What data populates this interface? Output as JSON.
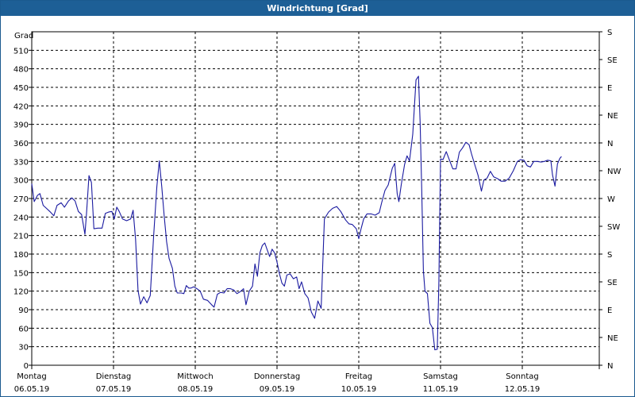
{
  "window": {
    "title": "Windrichtung [Grad]"
  },
  "chart_data": {
    "type": "line",
    "title": "Windrichtung [Grad]",
    "ylabel": "Grad",
    "ylim": [
      0,
      540
    ],
    "yticks": [
      0,
      30,
      60,
      90,
      120,
      150,
      180,
      210,
      240,
      270,
      300,
      330,
      360,
      390,
      420,
      450,
      480,
      510
    ],
    "right_axis_labels": [
      "N",
      "NE",
      "E",
      "SE",
      "S",
      "SW",
      "W",
      "NW",
      "N",
      "NE",
      "E",
      "SE",
      "S"
    ],
    "x_unit": "days",
    "xlim": [
      0,
      7
    ],
    "day_labels": [
      {
        "day": "Montag",
        "date": "06.05.19"
      },
      {
        "day": "Dienstag",
        "date": "07.05.19"
      },
      {
        "day": "Mittwoch",
        "date": "08.05.19"
      },
      {
        "day": "Donnerstag",
        "date": "09.05.19"
      },
      {
        "day": "Freitag",
        "date": "10.05.19"
      },
      {
        "day": "Samstag",
        "date": "11.05.19"
      },
      {
        "day": "Sonntag",
        "date": "12.05.19"
      }
    ],
    "grid": true,
    "series": [
      {
        "color": "#1a1aa0",
        "points": [
          [
            0.0,
            294
          ],
          [
            0.03,
            265
          ],
          [
            0.07,
            275
          ],
          [
            0.1,
            278
          ],
          [
            0.14,
            259
          ],
          [
            0.18,
            254
          ],
          [
            0.22,
            249
          ],
          [
            0.27,
            242
          ],
          [
            0.31,
            259
          ],
          [
            0.36,
            263
          ],
          [
            0.4,
            256
          ],
          [
            0.45,
            266
          ],
          [
            0.49,
            271
          ],
          [
            0.53,
            266
          ],
          [
            0.57,
            249
          ],
          [
            0.61,
            244
          ],
          [
            0.65,
            212
          ],
          [
            0.67,
            246
          ],
          [
            0.7,
            307
          ],
          [
            0.73,
            296
          ],
          [
            0.76,
            221
          ],
          [
            0.81,
            222
          ],
          [
            0.86,
            222
          ],
          [
            0.9,
            246
          ],
          [
            0.94,
            248
          ],
          [
            0.98,
            249
          ],
          [
            1.01,
            237
          ],
          [
            1.04,
            256
          ],
          [
            1.07,
            249
          ],
          [
            1.11,
            237
          ],
          [
            1.16,
            234
          ],
          [
            1.21,
            237
          ],
          [
            1.24,
            251
          ],
          [
            1.27,
            204
          ],
          [
            1.3,
            121
          ],
          [
            1.33,
            99
          ],
          [
            1.37,
            111
          ],
          [
            1.41,
            101
          ],
          [
            1.45,
            113
          ],
          [
            1.49,
            208
          ],
          [
            1.53,
            289
          ],
          [
            1.56,
            331
          ],
          [
            1.59,
            289
          ],
          [
            1.62,
            241
          ],
          [
            1.65,
            200
          ],
          [
            1.68,
            173
          ],
          [
            1.72,
            157
          ],
          [
            1.75,
            128
          ],
          [
            1.78,
            117
          ],
          [
            1.83,
            117
          ],
          [
            1.86,
            116
          ],
          [
            1.89,
            129
          ],
          [
            1.92,
            125
          ],
          [
            1.95,
            125
          ],
          [
            1.98,
            127
          ],
          [
            2.02,
            124
          ],
          [
            2.06,
            120
          ],
          [
            2.1,
            107
          ],
          [
            2.15,
            105
          ],
          [
            2.2,
            98
          ],
          [
            2.23,
            94
          ],
          [
            2.27,
            115
          ],
          [
            2.31,
            118
          ],
          [
            2.35,
            117
          ],
          [
            2.39,
            124
          ],
          [
            2.43,
            124
          ],
          [
            2.47,
            122
          ],
          [
            2.51,
            116
          ],
          [
            2.55,
            119
          ],
          [
            2.59,
            124
          ],
          [
            2.62,
            98
          ],
          [
            2.66,
            120
          ],
          [
            2.7,
            128
          ],
          [
            2.73,
            164
          ],
          [
            2.76,
            144
          ],
          [
            2.79,
            182
          ],
          [
            2.82,
            194
          ],
          [
            2.85,
            198
          ],
          [
            2.88,
            187
          ],
          [
            2.91,
            176
          ],
          [
            2.94,
            188
          ],
          [
            2.97,
            182
          ],
          [
            3.0,
            167
          ],
          [
            3.03,
            148
          ],
          [
            3.06,
            133
          ],
          [
            3.09,
            128
          ],
          [
            3.12,
            146
          ],
          [
            3.16,
            148
          ],
          [
            3.2,
            140
          ],
          [
            3.24,
            143
          ],
          [
            3.27,
            124
          ],
          [
            3.3,
            135
          ],
          [
            3.34,
            116
          ],
          [
            3.38,
            109
          ],
          [
            3.42,
            86
          ],
          [
            3.46,
            76
          ],
          [
            3.5,
            104
          ],
          [
            3.54,
            92
          ],
          [
            3.58,
            237
          ],
          [
            3.63,
            248
          ],
          [
            3.68,
            254
          ],
          [
            3.73,
            257
          ],
          [
            3.78,
            249
          ],
          [
            3.84,
            235
          ],
          [
            3.88,
            229
          ],
          [
            3.92,
            228
          ],
          [
            3.97,
            221
          ],
          [
            4.0,
            205
          ],
          [
            4.03,
            222
          ],
          [
            4.06,
            237
          ],
          [
            4.1,
            245
          ],
          [
            4.15,
            245
          ],
          [
            4.2,
            243
          ],
          [
            4.25,
            247
          ],
          [
            4.28,
            263
          ],
          [
            4.32,
            283
          ],
          [
            4.36,
            292
          ],
          [
            4.41,
            319
          ],
          [
            4.44,
            327
          ],
          [
            4.47,
            278
          ],
          [
            4.49,
            265
          ],
          [
            4.52,
            293
          ],
          [
            4.56,
            325
          ],
          [
            4.59,
            339
          ],
          [
            4.62,
            331
          ],
          [
            4.66,
            374
          ],
          [
            4.7,
            462
          ],
          [
            4.73,
            468
          ],
          [
            4.75,
            393
          ],
          [
            4.77,
            285
          ],
          [
            4.79,
            153
          ],
          [
            4.81,
            120
          ],
          [
            4.84,
            116
          ],
          [
            4.87,
            68
          ],
          [
            4.9,
            61
          ],
          [
            4.93,
            25
          ],
          [
            4.96,
            26
          ],
          [
            4.98,
            134
          ],
          [
            5.0,
            334
          ],
          [
            5.03,
            333
          ],
          [
            5.07,
            346
          ],
          [
            5.11,
            332
          ],
          [
            5.15,
            318
          ],
          [
            5.19,
            318
          ],
          [
            5.23,
            345
          ],
          [
            5.27,
            352
          ],
          [
            5.31,
            361
          ],
          [
            5.35,
            357
          ],
          [
            5.38,
            342
          ],
          [
            5.42,
            324
          ],
          [
            5.46,
            307
          ],
          [
            5.5,
            282
          ],
          [
            5.53,
            300
          ],
          [
            5.57,
            303
          ],
          [
            5.61,
            314
          ],
          [
            5.65,
            305
          ],
          [
            5.7,
            302
          ],
          [
            5.74,
            298
          ],
          [
            5.79,
            298
          ],
          [
            5.84,
            303
          ],
          [
            5.89,
            315
          ],
          [
            5.94,
            330
          ],
          [
            5.98,
            333
          ],
          [
            6.02,
            332
          ],
          [
            6.06,
            323
          ],
          [
            6.1,
            321
          ],
          [
            6.14,
            330
          ],
          [
            6.18,
            330
          ],
          [
            6.23,
            329
          ],
          [
            6.27,
            330
          ],
          [
            6.31,
            332
          ],
          [
            6.35,
            331
          ],
          [
            6.37,
            308
          ],
          [
            6.4,
            290
          ],
          [
            6.43,
            326
          ],
          [
            6.46,
            335
          ],
          [
            6.48,
            338
          ]
        ]
      }
    ]
  }
}
